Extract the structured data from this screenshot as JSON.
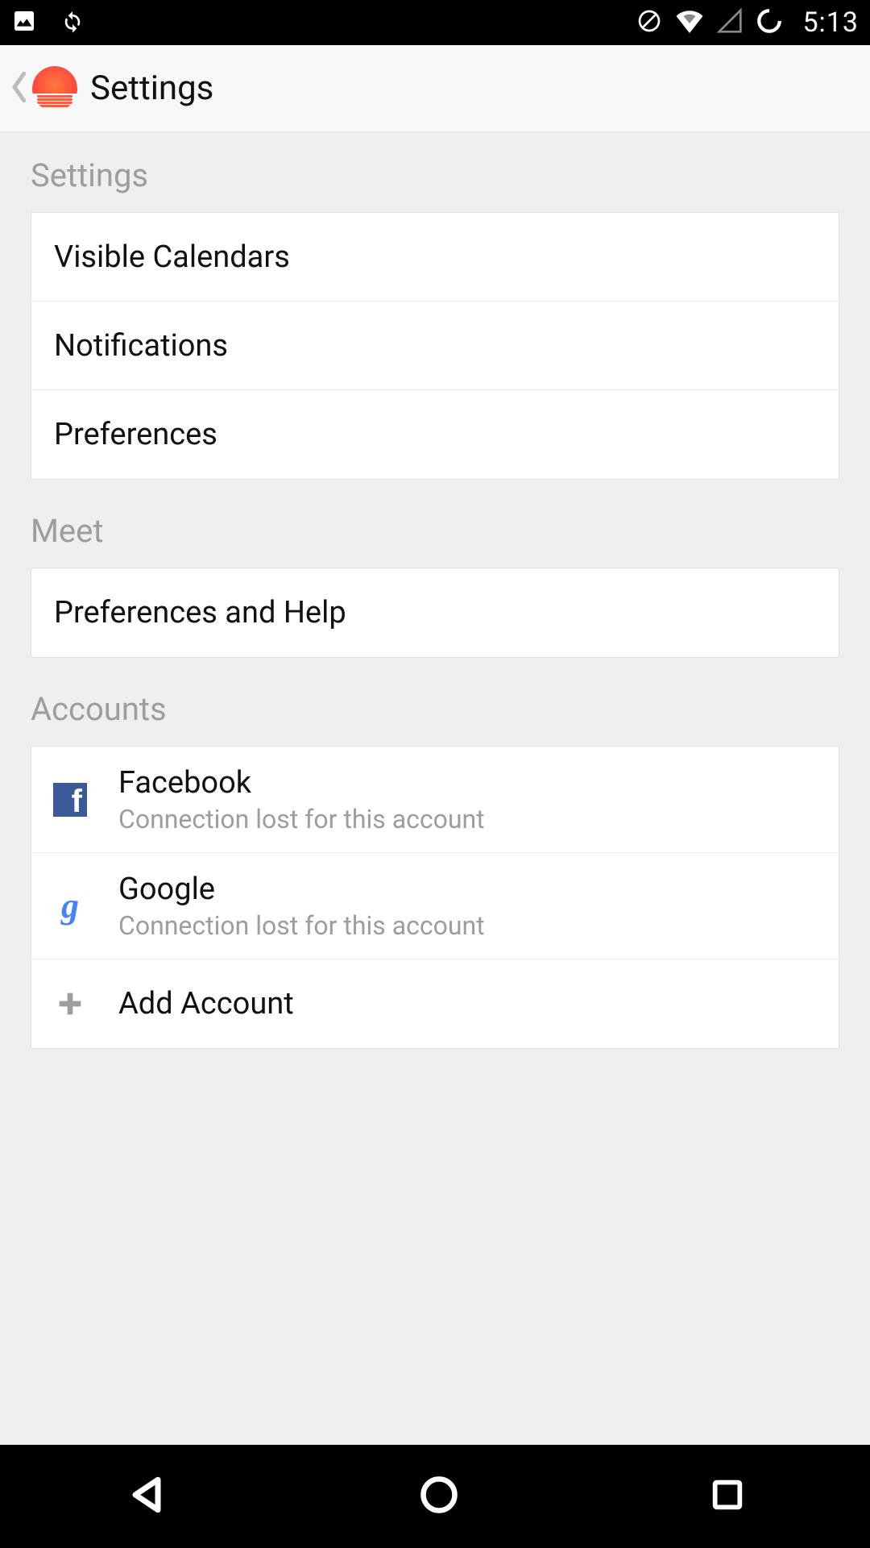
{
  "status": {
    "time": "5:13"
  },
  "header": {
    "title": "Settings"
  },
  "sections": {
    "settings": {
      "title": "Settings",
      "items": [
        "Visible Calendars",
        "Notifications",
        "Preferences"
      ]
    },
    "meet": {
      "title": "Meet",
      "items": [
        "Preferences and Help"
      ]
    },
    "accounts": {
      "title": "Accounts",
      "facebook": {
        "label": "Facebook",
        "status": "Connection lost for this account"
      },
      "google": {
        "label": "Google",
        "status": "Connection lost for this account"
      },
      "add": {
        "label": "Add Account"
      }
    }
  }
}
